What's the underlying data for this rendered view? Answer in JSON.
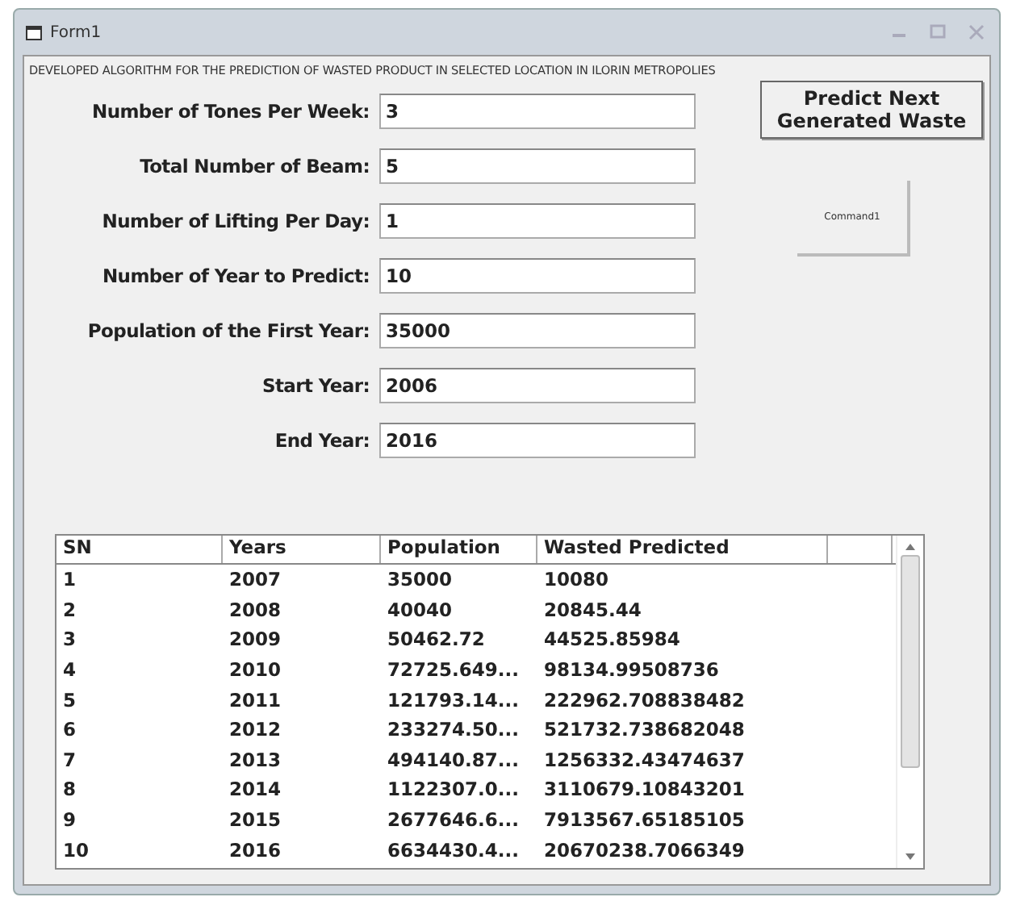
{
  "window": {
    "title": "Form1"
  },
  "heading": "DEVELOPED ALGORITHM FOR THE PREDICTION OF WASTED PRODUCT IN SELECTED LOCATION IN ILORIN METROPOLIES",
  "fields": [
    {
      "label": "Number of Tones Per Week:",
      "value": "3"
    },
    {
      "label": "Total Number of Beam:",
      "value": "5"
    },
    {
      "label": "Number of Lifting Per Day:",
      "value": "1"
    },
    {
      "label": "Number of Year to Predict:",
      "value": "10"
    },
    {
      "label": "Population of the First Year:",
      "value": "35000"
    },
    {
      "label": "Start Year:",
      "value": "2006"
    },
    {
      "label": "End Year:",
      "value": "2016"
    }
  ],
  "buttons": [
    {
      "label": "Predict Next Generated Waste",
      "kind": "primary"
    },
    {
      "label": "Command1",
      "kind": "small"
    }
  ],
  "table": {
    "columns": [
      "SN",
      "Years",
      "Population",
      "Wasted Predicted"
    ],
    "rows": [
      [
        "1",
        "2007",
        "35000",
        "10080"
      ],
      [
        "2",
        "2008",
        "40040",
        "20845.44"
      ],
      [
        "3",
        "2009",
        "50462.72",
        "44525.85984"
      ],
      [
        "4",
        "2010",
        "72725.649...",
        "98134.99508736"
      ],
      [
        "5",
        "2011",
        "121793.14...",
        "222962.708838482"
      ],
      [
        "6",
        "2012",
        "233274.50...",
        "521732.738682048"
      ],
      [
        "7",
        "2013",
        "494140.87...",
        "1256332.43474637"
      ],
      [
        "8",
        "2014",
        "1122307.0...",
        "3110679.10843201"
      ],
      [
        "9",
        "2015",
        "2677646.6...",
        "7913567.65185105"
      ],
      [
        "10",
        "2016",
        "6634430.4...",
        "20670238.7066349"
      ]
    ]
  }
}
